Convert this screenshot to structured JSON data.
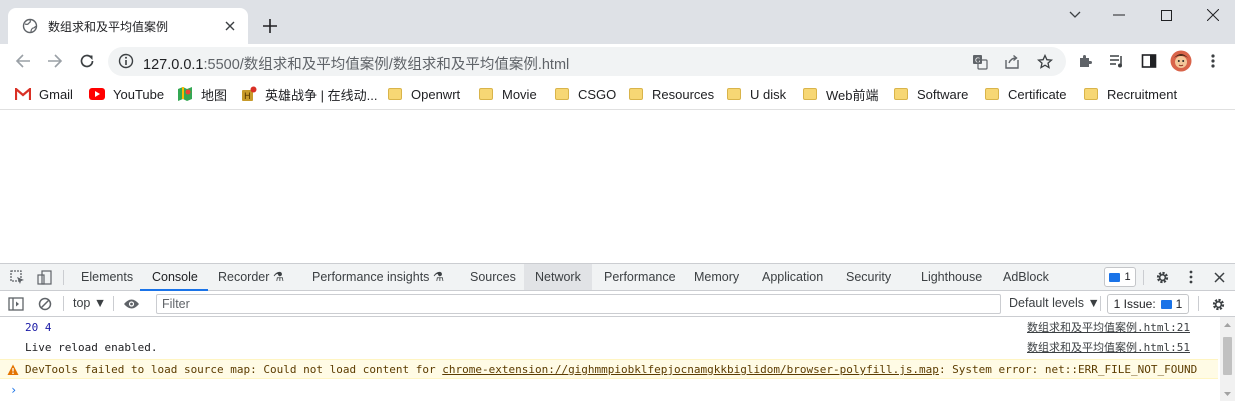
{
  "tab": {
    "title": "数组求和及平均值案例",
    "favicon": "globe-icon"
  },
  "omnibox": {
    "url_host": "127.0.0.1",
    "url_rest": ":5500/数组求和及平均值案例/数组求和及平均值案例.html"
  },
  "bookmarks": [
    {
      "label": "Gmail",
      "icon": "gmail-icon"
    },
    {
      "label": "YouTube",
      "icon": "youtube-icon"
    },
    {
      "label": "地图",
      "icon": "maps-icon"
    },
    {
      "label": "英雄战争 | 在线动...",
      "icon": "game-icon"
    },
    {
      "label": "Openwrt",
      "icon": "folder-icon"
    },
    {
      "label": "Movie",
      "icon": "folder-icon"
    },
    {
      "label": "CSGO",
      "icon": "folder-icon"
    },
    {
      "label": "Resources",
      "icon": "folder-icon"
    },
    {
      "label": "U disk",
      "icon": "folder-icon"
    },
    {
      "label": "Web前端",
      "icon": "folder-icon"
    },
    {
      "label": "Software",
      "icon": "folder-icon"
    },
    {
      "label": "Certificate",
      "icon": "folder-icon"
    },
    {
      "label": "Recruitment",
      "icon": "folder-icon"
    }
  ],
  "devtools": {
    "tabs": [
      "Elements",
      "Console",
      "Recorder",
      "Performance insights",
      "Sources",
      "Network",
      "Performance",
      "Memory",
      "Application",
      "Security",
      "Lighthouse",
      "AdBlock"
    ],
    "active_tab": "Console",
    "issue_count": "1",
    "context": "top",
    "filter_placeholder": "Filter",
    "levels": "Default levels",
    "issues_label": "1 Issue:",
    "issues_count": "1",
    "messages": [
      {
        "text": "20 4",
        "source": "数组求和及平均值案例.html:21"
      },
      {
        "text": "Live reload enabled.",
        "source": "数组求和及平均值案例.html:51"
      }
    ],
    "warning": {
      "prefix": "DevTools failed to load source map: Could not load content for ",
      "link": "chrome-extension://gighmmpiobklfepjocnamgkkbiglidom/browser-polyfill.js.map",
      "suffix": ": System error: net::ERR_FILE_NOT_FOUND"
    },
    "prompt": "›"
  },
  "colors": {
    "accent": "#1a73e8",
    "tabstrip": "#dee1e6",
    "warning_bg": "#fffbe5"
  }
}
